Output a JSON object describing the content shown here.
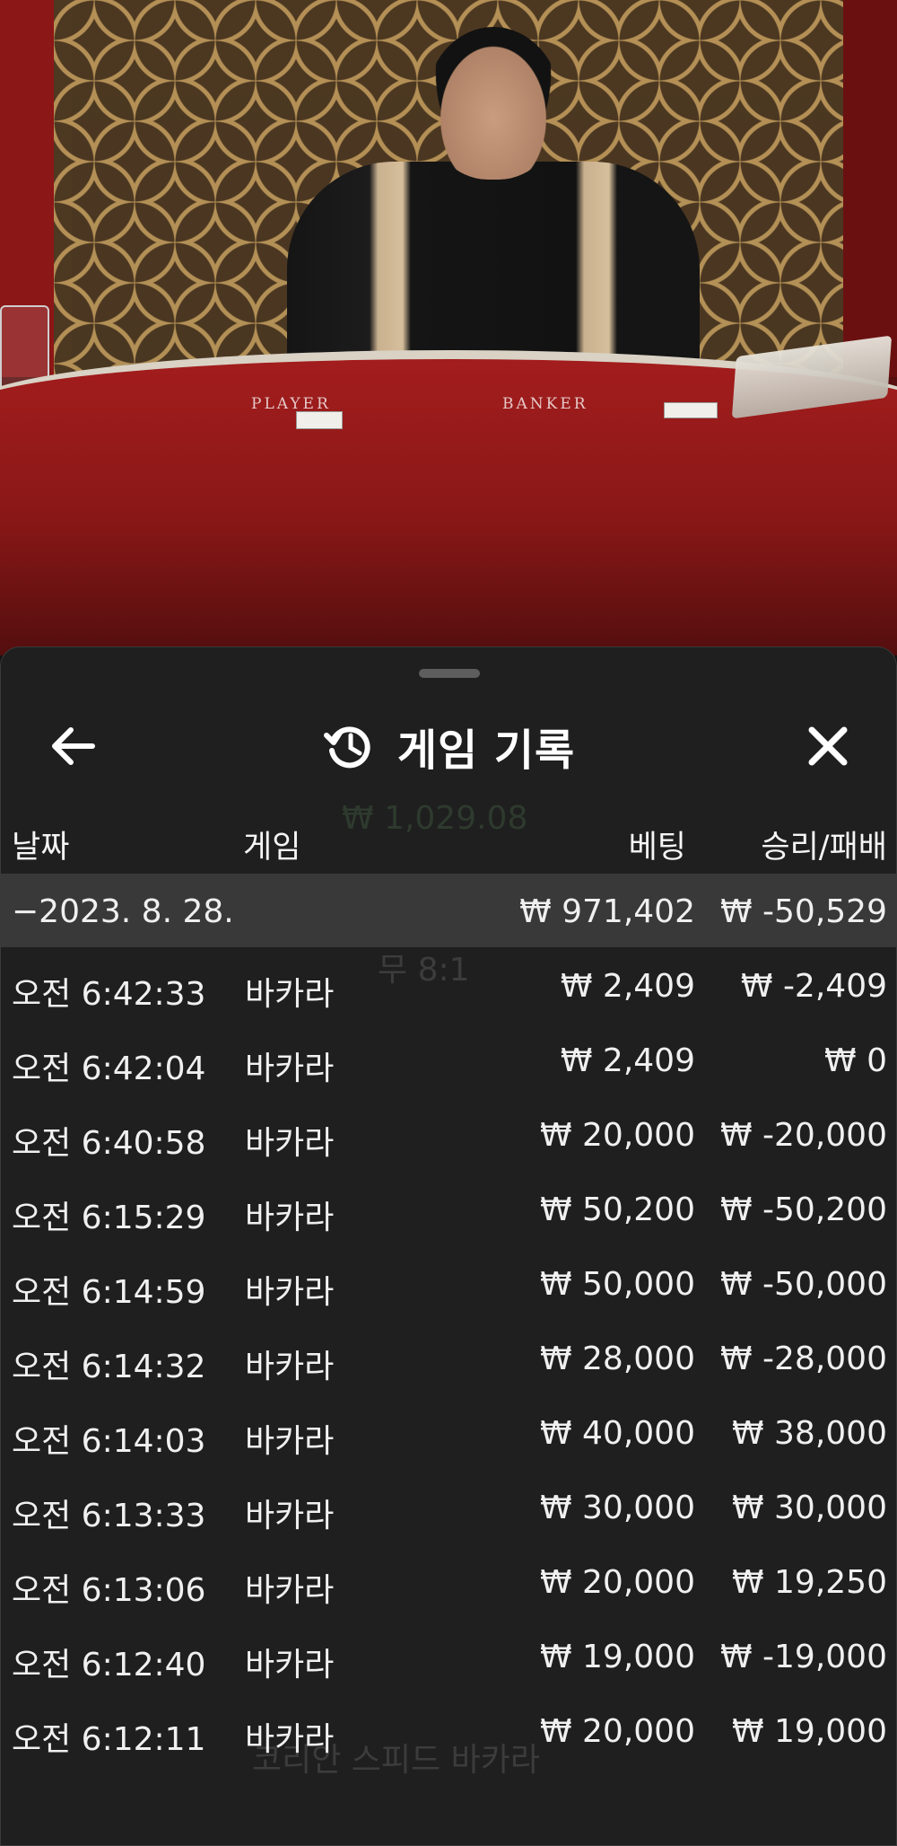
{
  "video": {
    "table_label_player": "PLAYER",
    "table_label_banker": "BANKER"
  },
  "sheet": {
    "title": "게임 기록",
    "icons": {
      "back": "arrow-left-icon",
      "history": "history-icon",
      "close": "close-icon"
    },
    "columns": {
      "date": "날짜",
      "game": "게임",
      "bet": "베팅",
      "win_loss": "승리/패배"
    },
    "group": {
      "date": "−2023. 8. 28.",
      "bet_total": "₩ 971,402",
      "win_loss_total": "₩ -50,529"
    },
    "rows": [
      {
        "time": "오전 6:42:33",
        "game": "바카라",
        "bet": "₩ 2,409",
        "win_loss": "₩ -2,409"
      },
      {
        "time": "오전 6:42:04",
        "game": "바카라",
        "bet": "₩ 2,409",
        "win_loss": "₩ 0"
      },
      {
        "time": "오전 6:40:58",
        "game": "바카라",
        "bet": "₩ 20,000",
        "win_loss": "₩ -20,000"
      },
      {
        "time": "오전 6:15:29",
        "game": "바카라",
        "bet": "₩ 50,200",
        "win_loss": "₩ -50,200"
      },
      {
        "time": "오전 6:14:59",
        "game": "바카라",
        "bet": "₩ 50,000",
        "win_loss": "₩ -50,000"
      },
      {
        "time": "오전 6:14:32",
        "game": "바카라",
        "bet": "₩ 28,000",
        "win_loss": "₩ -28,000"
      },
      {
        "time": "오전 6:14:03",
        "game": "바카라",
        "bet": "₩ 40,000",
        "win_loss": "₩ 38,000"
      },
      {
        "time": "오전 6:13:33",
        "game": "바카라",
        "bet": "₩ 30,000",
        "win_loss": "₩ 30,000"
      },
      {
        "time": "오전 6:13:06",
        "game": "바카라",
        "bet": "₩ 20,000",
        "win_loss": "₩ 19,250"
      },
      {
        "time": "오전 6:12:40",
        "game": "바카라",
        "bet": "₩ 19,000",
        "win_loss": "₩ -19,000"
      },
      {
        "time": "오전 6:12:11",
        "game": "바카라",
        "bet": "₩ 20,000",
        "win_loss": "₩ 19,000"
      }
    ]
  },
  "colors": {
    "sheet_bg": "#1f1f1f",
    "group_row_bg": "#393939",
    "text": "#f0f0f0"
  }
}
